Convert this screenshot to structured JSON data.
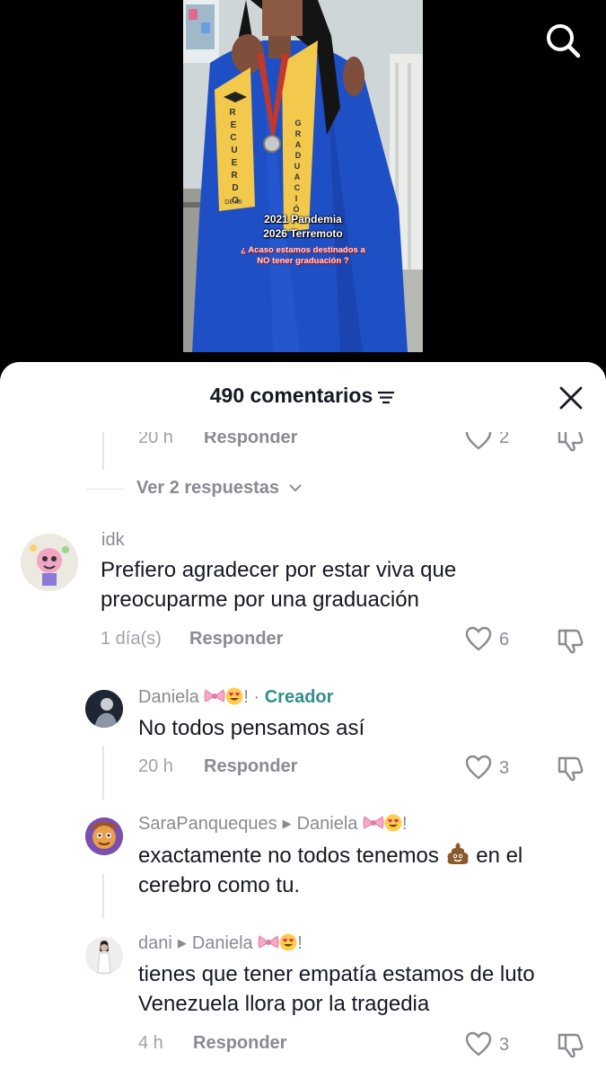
{
  "video": {
    "overlay_line1": "2021 Pandemia",
    "overlay_line2": "2026 Terremoto",
    "overlay_line3a": "¿ Acaso estamos destinados a",
    "overlay_line3b": "NO tener graduación ?",
    "sash_left": "RECUERDO",
    "sash_left_sub": "DE MI",
    "sash_right": "GRADUACIÓN"
  },
  "header": {
    "comment_count": "490 comentarios"
  },
  "comments": {
    "prev": {
      "time": "20 h",
      "reply": "Responder",
      "likes": "2"
    },
    "view_replies": "Ver 2 respuestas",
    "c1": {
      "user": "idk",
      "text": "Prefiero agradecer por estar viva que preocuparme por una graduación",
      "time": "1 día(s)",
      "reply": "Responder",
      "likes": "6"
    },
    "r1": {
      "user": "Daniela",
      "user_suffix": "!",
      "creator_sep": " · ",
      "creator": "Creador",
      "text": "No todos pensamos así",
      "time": "20 h",
      "reply": "Responder",
      "likes": "3"
    },
    "r2": {
      "user": "SaraPanqueques",
      "target": "Daniela",
      "target_suffix": "!",
      "text_a": "exactamente no todos tenemos",
      "text_b": "en el cerebro como tu."
    },
    "r3": {
      "user": "dani",
      "target": "Daniela",
      "target_suffix": "!",
      "text": "tienes que tener empatía estamos de luto Venezuela llora por la tragedia",
      "time": "4 h",
      "reply": "Responder",
      "likes": "3"
    }
  },
  "colors": {
    "creator": "#2f8f8a",
    "muted": "#8a8b91",
    "text": "#161823",
    "gown": "#1f4fc4",
    "sash": "#f2c94c"
  },
  "icons": [
    "search-icon",
    "filter-icon",
    "close-icon",
    "heart-icon",
    "dislike-icon",
    "chevron-down-icon",
    "bow-emoji",
    "heart-eyes-emoji",
    "poop-emoji"
  ]
}
